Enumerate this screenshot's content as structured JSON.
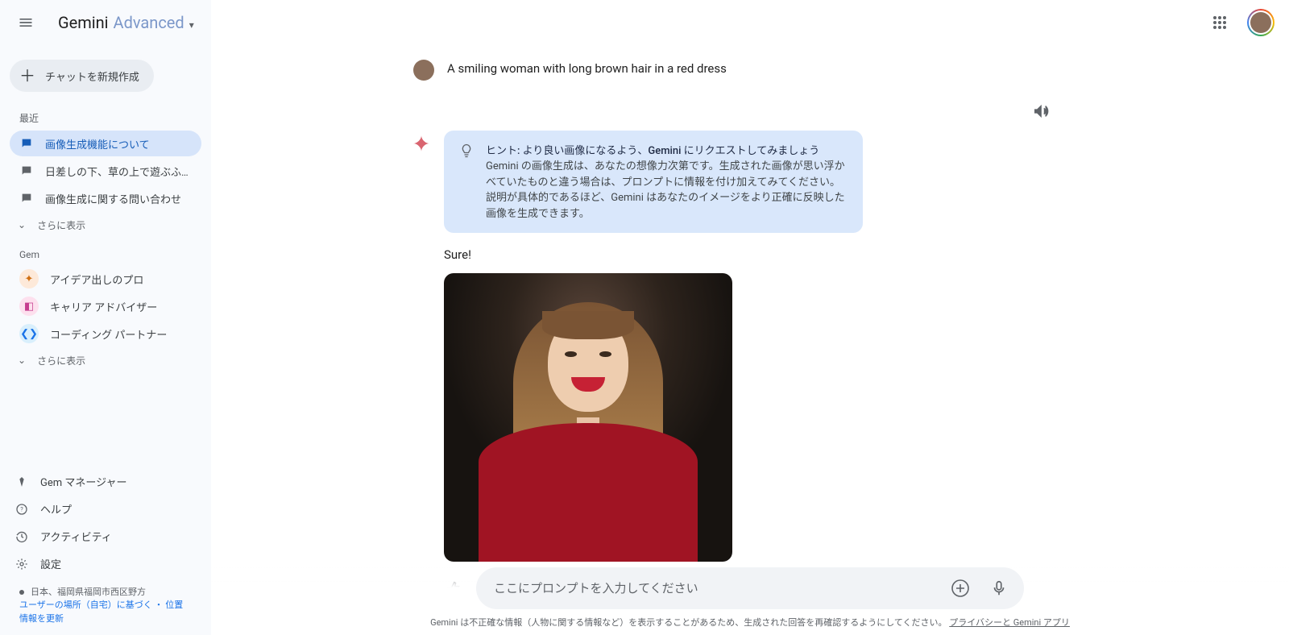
{
  "header": {
    "logo_primary": "Gemini",
    "logo_secondary": "Advanced"
  },
  "sidebar": {
    "new_chat_label": "チャットを新規作成",
    "recent_label": "最近",
    "recent_items": [
      "画像生成機能について",
      "日差しの下、草の上で遊ぶふ…",
      "画像生成に関する問い合わせ"
    ],
    "more_label": "さらに表示",
    "gem_label": "Gem",
    "gem_items": [
      "アイデア出しのプロ",
      "キャリア アドバイザー",
      "コーディング パートナー"
    ],
    "footer_items": [
      "Gem マネージャー",
      "ヘルプ",
      "アクティビティ",
      "設定"
    ],
    "location_text": "日本、福岡県福岡市西区野方",
    "location_basis": "ユーザーの場所（自宅）に基づく",
    "location_sep": "・",
    "location_link": "位置情報を更新"
  },
  "conversation": {
    "user_prompt": "A smiling woman with long brown hair in a red dress",
    "hint_title": "ヒント: より良い画像になるよう、Gemini にリクエストしてみましょう",
    "hint_body": "Gemini の画像生成は、あなたの想像力次第です。生成された画像が思い浮かべていたものと違う場合は、プロンプトに情報を付け加えてみてください。説明が具体的であるほど、Gemini はあなたのイメージをより正確に反映した画像を生成できます。",
    "model_reply": "Sure!",
    "image_alt": "A smiling woman with long brown hair in a red dress"
  },
  "input": {
    "placeholder": "ここにプロンプトを入力してください"
  },
  "footer": {
    "disclaimer_text": "Gemini は不正確な情報（人物に関する情報など）を表示することがあるため、生成された回答を再確認するようにしてください。",
    "disclaimer_link": "プライバシーと Gemini アプリ"
  }
}
